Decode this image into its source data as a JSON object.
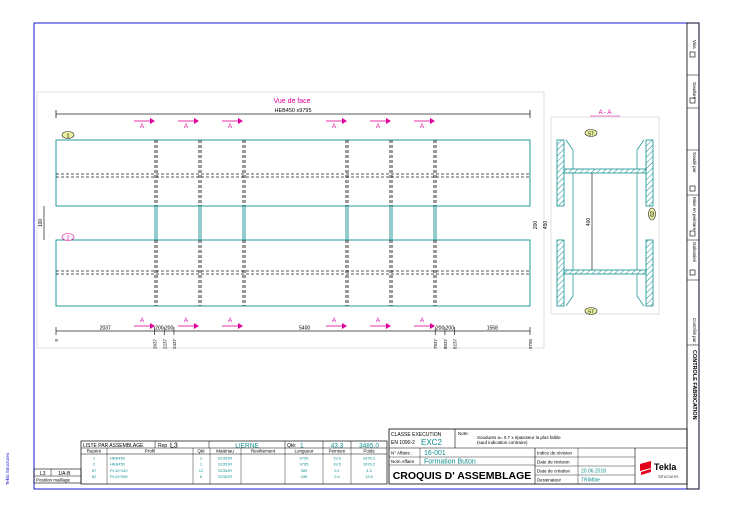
{
  "drawing": {
    "view_title": "Vue de face",
    "profile_label": "HEB450 x9795",
    "section_label": "A - A",
    "section_mark": "A",
    "mark_1": "1",
    "mark_2": "2",
    "mark_57a": "57",
    "mark_57b": "57",
    "mark_62": "62",
    "height_front": "450",
    "height_section": "450",
    "height_web": "400",
    "side_dim": "100",
    "side_dim_right": "200",
    "dims_bottom": [
      "2037",
      "200",
      "200",
      "5400",
      "200",
      "200",
      "1558"
    ],
    "dims_cumul": [
      "0",
      "2037",
      "2237",
      "2437",
      "7837",
      "8037",
      "8237",
      "9795"
    ]
  },
  "parts_list": {
    "title": "LISTE PAR ASSEMBLAGE",
    "rep_label": "Rep",
    "rep_value": "L3",
    "name": "LIERNE",
    "qty_label": "Qté:",
    "qty_value": "1",
    "area": "43.3",
    "weight": "3485.0",
    "headers": [
      "Repère",
      "Profil",
      "Qté",
      "Matériau",
      "Revêtement",
      "Longueur",
      "Peinture",
      "Poids"
    ],
    "rows": [
      [
        "1",
        "HEB450",
        "1",
        "S235JR",
        "",
        "9795",
        "19.5",
        "1676.2"
      ],
      [
        "2",
        "HEB450",
        "1",
        "S235JR",
        "",
        "9795",
        "19.5",
        "1676.2"
      ],
      [
        "57",
        "PL10*140",
        "12",
        "S235JR",
        "",
        "389",
        "0.1",
        "4.3"
      ],
      [
        "62",
        "PL10*395",
        "6",
        "S235JR",
        "",
        "435",
        "0.4",
        "13.5"
      ]
    ],
    "position_value": "L3",
    "position_code": "1/A-B",
    "position_label": "Position maillage"
  },
  "title_block": {
    "class_label": "CLASSE EXECUTION",
    "class_norm": "EN 1090-2",
    "class_value": "EXC2",
    "note_label": "Note:",
    "note_line1": "Soudures a= 0.7 x épaisseur la plus faible",
    "note_line2": "(sauf indication contraire)",
    "affaire_label": "N° Affaire :",
    "affaire_value": "16-001",
    "nom_label": "Nom Affaire",
    "nom_value": "Formation Buton",
    "drawing_title": "CROQUIS D' ASSEMBLAGE",
    "rev_index_label": "Indice de révision",
    "rev_date_label": "Date de révision",
    "creation_label": "Date de création",
    "creation_value": "20.06.2018",
    "drawer_label": "Dessinateur",
    "drawer_value": "TRIMble",
    "logo_name": "Tekla",
    "logo_sub": "Structures"
  },
  "side_strip": {
    "control": "CONTROLE FABRICATION",
    "visa_label": "Visa",
    "items": [
      "Soudure",
      "Soudé par",
      "Mise en peinture",
      "Galvanisé",
      "Contrôlé par :"
    ]
  },
  "footer": {
    "software": "Tekla Structures"
  },
  "colors": {
    "profile": "#0f8f8f",
    "annotation": "#e0009a",
    "frame": "#1b1bd0",
    "mark_fill": "#e9f0a0",
    "dim": "#202020"
  }
}
